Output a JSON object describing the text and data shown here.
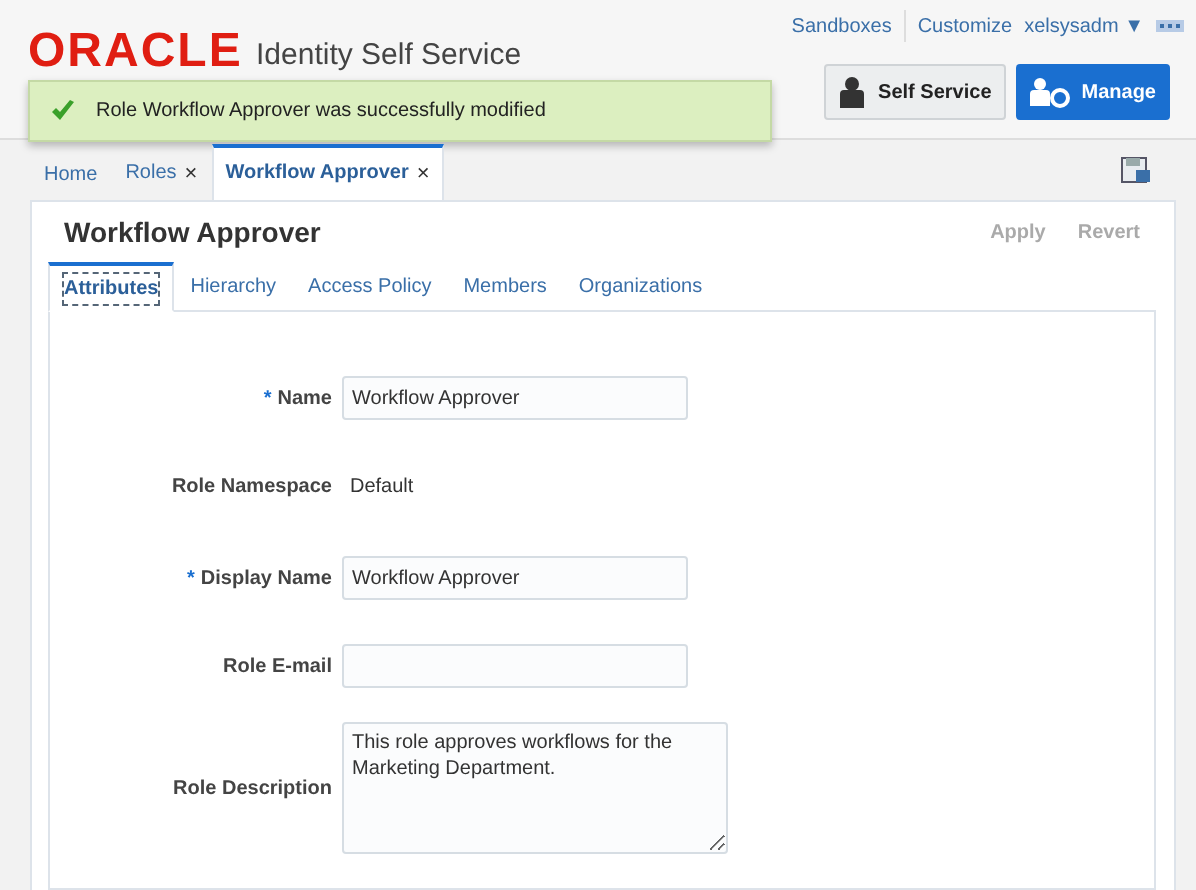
{
  "header": {
    "logo": "ORACLE",
    "product": "Identity Self Service",
    "links": [
      {
        "label": "Sandboxes"
      },
      {
        "label": "Customize"
      }
    ],
    "user": {
      "label": "xelsysadm",
      "caret": "▼"
    },
    "buttons": [
      {
        "label": "Self Service",
        "selected": false
      },
      {
        "label": "Manage",
        "selected": true
      }
    ]
  },
  "notification": {
    "text": "Role Workflow Approver was successfully modified"
  },
  "tabs": [
    {
      "label": "Home",
      "selected": false
    },
    {
      "label": "Roles",
      "close": "×",
      "selected": false
    },
    {
      "label": "Workflow Approver",
      "close": "×",
      "selected": true
    }
  ],
  "panel": {
    "title": "Workflow Approver",
    "actions": [
      {
        "label": "Apply",
        "disabled": true
      },
      {
        "label": "Revert",
        "disabled": true
      }
    ],
    "subtabs": [
      {
        "label": "Attributes",
        "selected": true
      },
      {
        "label": "Hierarchy",
        "selected": false
      },
      {
        "label": "Access Policy",
        "selected": false
      },
      {
        "label": "Members",
        "selected": false
      },
      {
        "label": "Organizations",
        "selected": false
      }
    ],
    "fields": [
      {
        "kind": "input",
        "label": "Name",
        "mark": "*",
        "value": "Workflow Approver"
      },
      {
        "kind": "text",
        "label": "Role Namespace",
        "value": "Default"
      },
      {
        "kind": "input",
        "label": "Display Name",
        "mark": "*",
        "value": "Workflow Approver"
      },
      {
        "kind": "input",
        "label": "Role E-mail"
      },
      {
        "kind": "textarea",
        "label": "Role Description",
        "value": "This role approves workflows for the Marketing Department."
      }
    ]
  }
}
